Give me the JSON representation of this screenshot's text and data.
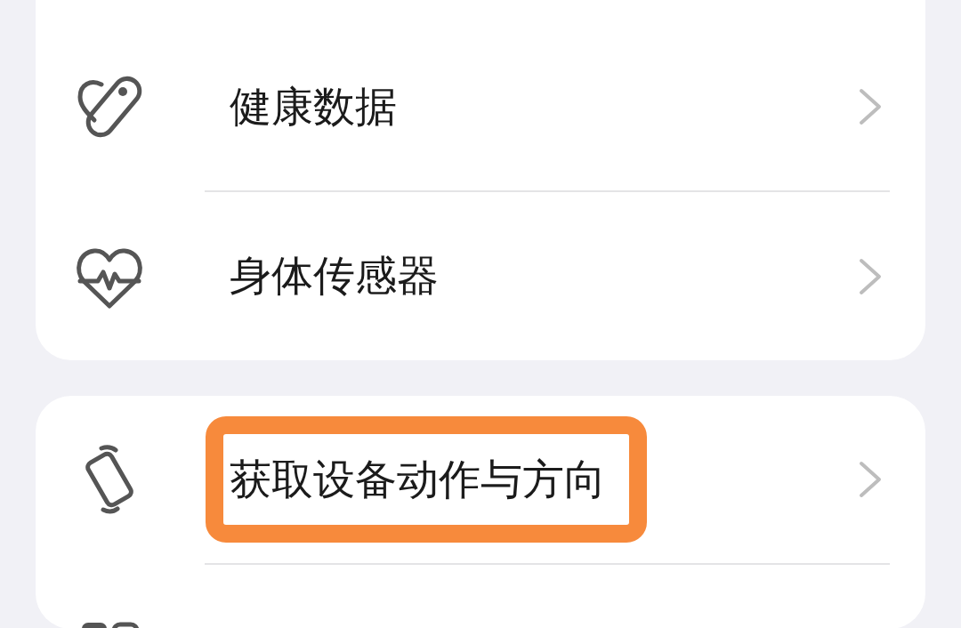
{
  "groups": [
    {
      "items": [
        {
          "kind": "setting",
          "label": "健康数据",
          "highlighted": false
        },
        {
          "kind": "setting",
          "label": "身体传感器",
          "highlighted": false
        }
      ]
    },
    {
      "items": [
        {
          "kind": "setting",
          "label": "获取设备动作与方向",
          "highlighted": true
        },
        {
          "kind": "partial"
        }
      ]
    }
  ]
}
